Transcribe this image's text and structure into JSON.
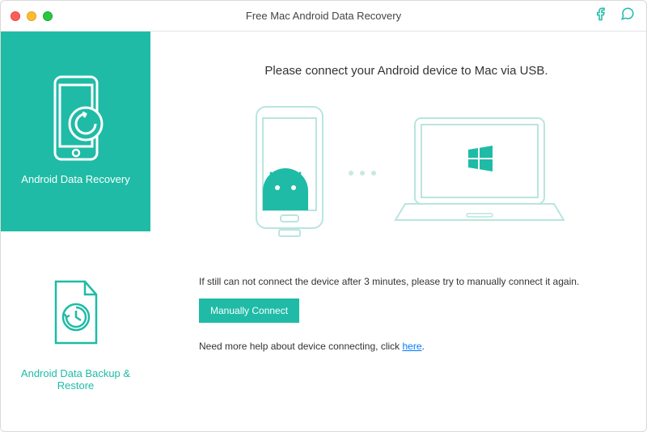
{
  "titlebar": {
    "title": "Free Mac Android Data Recovery"
  },
  "sidebar": {
    "items": [
      {
        "label": "Android Data Recovery"
      },
      {
        "label": "Android Data Backup & Restore"
      }
    ]
  },
  "content": {
    "heading": "Please connect your Android device to Mac via USB.",
    "warning": "If still can not connect the device after 3 minutes, please try to manually connect it again.",
    "manual_button": "Manually Connect",
    "help_prefix": "Need more help about device connecting, click ",
    "help_link": "here",
    "help_suffix": "."
  },
  "colors": {
    "accent": "#1fbba6"
  }
}
